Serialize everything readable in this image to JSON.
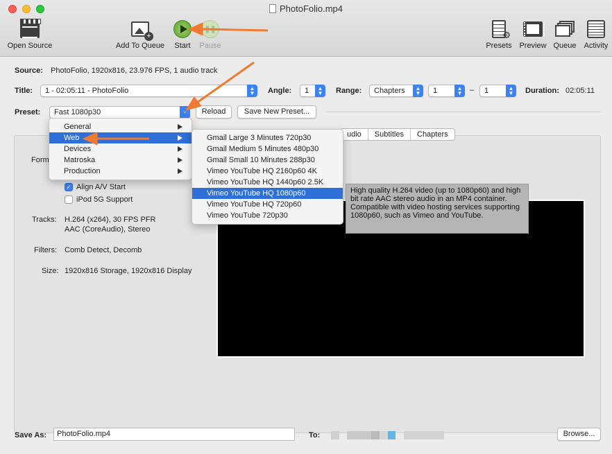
{
  "window": {
    "title": "PhotoFolio.mp4"
  },
  "toolbar": {
    "open_source": "Open Source",
    "add_to_queue": "Add To Queue",
    "start": "Start",
    "pause": "Pause",
    "presets": "Presets",
    "preview": "Preview",
    "queue": "Queue",
    "activity": "Activity"
  },
  "source": {
    "label": "Source:",
    "value": "PhotoFolio, 1920x816, 23.976 FPS, 1 audio track"
  },
  "title_row": {
    "label": "Title:",
    "value": "1 - 02:05:11 - PhotoFolio",
    "angle_label": "Angle:",
    "angle_value": "1",
    "range_label": "Range:",
    "range_type": "Chapters",
    "range_from": "1",
    "range_dash": "–",
    "range_to": "1",
    "duration_label": "Duration:",
    "duration_value": "02:05:11"
  },
  "preset_row": {
    "label": "Preset:",
    "value": "Fast 1080p30",
    "reload": "Reload",
    "save_new": "Save New Preset..."
  },
  "tabs": [
    "udio",
    "Subtitles",
    "Chapters"
  ],
  "summary": {
    "format_label": "Form",
    "align_av": "Align A/V Start",
    "ipod": "iPod 5G Support",
    "tracks_label": "Tracks:",
    "tracks_line1": "H.264 (x264), 30 FPS PFR",
    "tracks_line2": "AAC (CoreAudio), Stereo",
    "filters_label": "Filters:",
    "filters_value": "Comb Detect, Decomb",
    "size_label": "Size:",
    "size_value": "1920x816 Storage, 1920x816 Display"
  },
  "preset_menu": {
    "categories": [
      "General",
      "Web",
      "Devices",
      "Matroska",
      "Production"
    ],
    "selected_category": "Web",
    "web_items": [
      "Gmail Large 3 Minutes 720p30",
      "Gmail Medium 5 Minutes 480p30",
      "Gmail Small 10 Minutes 288p30",
      "Vimeo YouTube HQ 2160p60 4K",
      "Vimeo YouTube HQ 1440p60 2.5K",
      "Vimeo YouTube HQ 1080p60",
      "Vimeo YouTube HQ 720p60",
      "Vimeo YouTube 720p30"
    ],
    "selected_item": "Vimeo YouTube HQ 1080p60"
  },
  "tooltip": "High quality H.264 video (up to 1080p60) and high bit rate AAC stereo audio in an MP4 container. Compatible with video hosting services supporting 1080p60, such as Vimeo and YouTube.",
  "save": {
    "label": "Save As:",
    "value": "PhotoFolio.mp4",
    "to_label": "To:",
    "browse": "Browse..."
  },
  "colors": {
    "accent": "#2f6fd8",
    "annotation_arrow": "#f07a30"
  }
}
